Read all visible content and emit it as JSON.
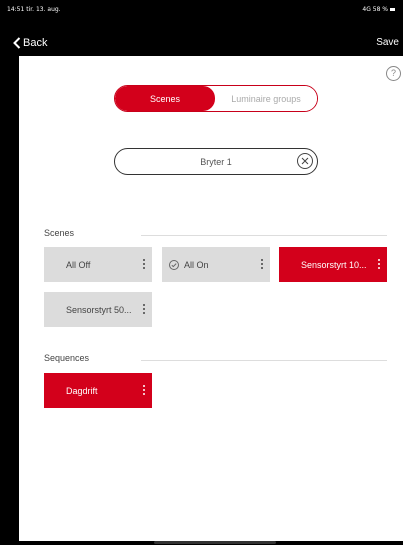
{
  "status_bar": {
    "time_date": "14:51 tir. 13. aug.",
    "network": "4G 58 %"
  },
  "nav": {
    "back_label": "Back",
    "save_label": "Save"
  },
  "help": {
    "symbol": "?"
  },
  "segmented": {
    "tabs": [
      {
        "label": "Scenes",
        "active": true
      },
      {
        "label": "Luminaire groups",
        "active": false
      }
    ]
  },
  "search": {
    "value": "Bryter 1"
  },
  "scenes": {
    "header": "Scenes",
    "items": [
      {
        "label": "All Off",
        "style": "gray"
      },
      {
        "label": "All On",
        "style": "gray",
        "icon": "check-circle-icon"
      },
      {
        "label": "Sensorstyrt 10...",
        "style": "red"
      },
      {
        "label": "Sensorstyrt 50...",
        "style": "gray"
      }
    ]
  },
  "sequences": {
    "header": "Sequences",
    "items": [
      {
        "label": "Dagdrift",
        "style": "red"
      }
    ]
  },
  "colors": {
    "accent": "#d3001b",
    "tile_gray": "#dcdcdc",
    "background": "#ffffff",
    "chrome": "#000000"
  }
}
